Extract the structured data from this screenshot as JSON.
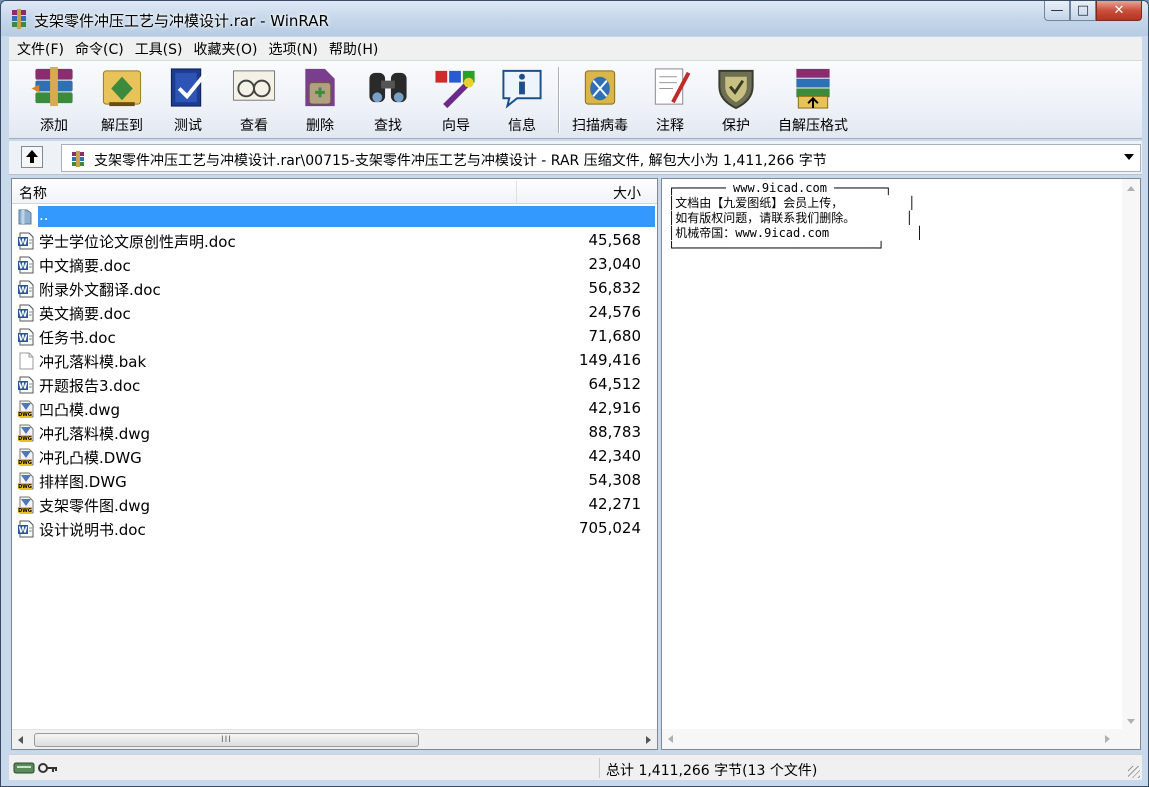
{
  "window": {
    "title": "支架零件冲压工艺与冲模设计.rar - WinRAR",
    "controls": {
      "minimize": "—",
      "maximize": "□",
      "close": "✕"
    }
  },
  "menu": [
    "文件(F)",
    "命令(C)",
    "工具(S)",
    "收藏夹(O)",
    "选项(N)",
    "帮助(H)"
  ],
  "toolbar": [
    {
      "label": "添加",
      "icon": "add-icon"
    },
    {
      "label": "解压到",
      "icon": "extract-icon"
    },
    {
      "label": "测试",
      "icon": "test-icon"
    },
    {
      "label": "查看",
      "icon": "view-icon"
    },
    {
      "label": "删除",
      "icon": "delete-icon"
    },
    {
      "label": "查找",
      "icon": "find-icon"
    },
    {
      "label": "向导",
      "icon": "wizard-icon"
    },
    {
      "label": "信息",
      "icon": "info-icon"
    },
    {
      "label": "扫描病毒",
      "icon": "virus-scan-icon"
    },
    {
      "label": "注释",
      "icon": "comment-icon"
    },
    {
      "label": "保护",
      "icon": "protect-icon"
    },
    {
      "label": "自解压格式",
      "icon": "sfx-icon"
    }
  ],
  "address": {
    "path": "支架零件冲压工艺与冲模设计.rar\\00715-支架零件冲压工艺与冲模设计 - RAR 压缩文件, 解包大小为 1,411,266 字节"
  },
  "list": {
    "headers": {
      "name": "名称",
      "size": "大小"
    },
    "files": [
      {
        "name": "..",
        "size": "",
        "type": "folder-up"
      },
      {
        "name": "学士学位论文原创性声明.doc",
        "size": "45,568",
        "type": "doc"
      },
      {
        "name": "中文摘要.doc",
        "size": "23,040",
        "type": "doc"
      },
      {
        "name": "附录外文翻译.doc",
        "size": "56,832",
        "type": "doc"
      },
      {
        "name": "英文摘要.doc",
        "size": "24,576",
        "type": "doc"
      },
      {
        "name": "任务书.doc",
        "size": "71,680",
        "type": "doc"
      },
      {
        "name": "冲孔落料模.bak",
        "size": "149,416",
        "type": "bak"
      },
      {
        "name": "开题报告3.doc",
        "size": "64,512",
        "type": "doc"
      },
      {
        "name": "凹凸模.dwg",
        "size": "42,916",
        "type": "dwg"
      },
      {
        "name": "冲孔落料模.dwg",
        "size": "88,783",
        "type": "dwg"
      },
      {
        "name": "冲孔凸模.DWG",
        "size": "42,340",
        "type": "dwg"
      },
      {
        "name": "排样图.DWG",
        "size": "54,308",
        "type": "dwg"
      },
      {
        "name": "支架零件图.dwg",
        "size": "42,271",
        "type": "dwg"
      },
      {
        "name": "设计说明书.doc",
        "size": "705,024",
        "type": "doc"
      }
    ],
    "scroll_grip": "III"
  },
  "comment": {
    "text": "┌─────── www.9icad.com ───────┐\n│文档由【九爱图纸】会员上传，         │\n│如有版权问题，请联系我们删除。       │\n│机械帝国：www.9icad.com            │\n└────────────────────────────┘"
  },
  "status": {
    "total": "总计 1,411,266 字节(13 个文件)"
  },
  "colors": {
    "selection": "#3399ff",
    "close_button": "#c8503b"
  }
}
